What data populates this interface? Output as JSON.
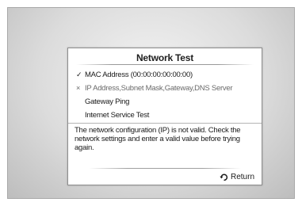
{
  "dialog": {
    "title": "Network Test",
    "tests": [
      {
        "status": "pass",
        "mark": "✓",
        "label": "MAC Address (00:00:00:00:00:00)"
      },
      {
        "status": "fail",
        "mark": "×",
        "label": "IP Address,Subnet Mask,Gateway,DNS Server"
      },
      {
        "status": "pending",
        "mark": "",
        "label": "Gateway Ping"
      },
      {
        "status": "pending",
        "mark": "",
        "label": "Internet Service Test"
      }
    ],
    "message": "The network configuration (IP) is not valid. Check the network settings and enter a valid value before trying again.",
    "return_label": "Return",
    "return_icon": "return-arrow-icon"
  },
  "colors": {
    "text": "#1a1a1a",
    "fail_text": "#6a6a6a",
    "dialog_border": "#8e8e8e"
  }
}
